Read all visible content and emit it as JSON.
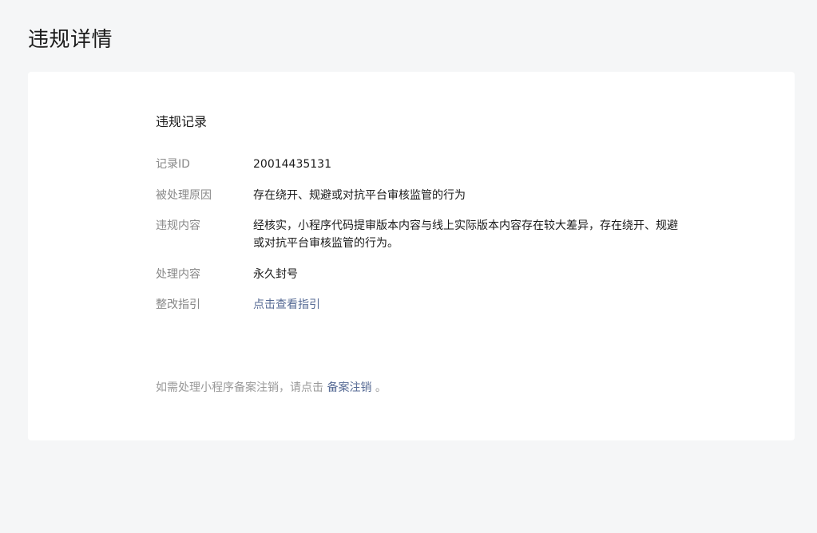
{
  "page": {
    "title": "违规详情"
  },
  "record": {
    "section_title": "违规记录",
    "rows": [
      {
        "label": "记录ID",
        "value": "20014435131"
      },
      {
        "label": "被处理原因",
        "value": "存在绕开、规避或对抗平台审核监管的行为"
      },
      {
        "label": "违规内容",
        "value": "经核实，小程序代码提审版本内容与线上实际版本内容存在较大差异，存在绕开、规避或对抗平台审核监管的行为。"
      },
      {
        "label": "处理内容",
        "value": "永久封号"
      },
      {
        "label": "整改指引",
        "value": "点击查看指引"
      }
    ]
  },
  "footer": {
    "text_before": "如需处理小程序备案注销，请点击 ",
    "link_label": "备案注销",
    "text_after": " 。"
  },
  "colors": {
    "background": "#f5f6f7",
    "card": "#ffffff",
    "label": "#888888",
    "link": "#576b95",
    "text": "#1a1a1a"
  }
}
